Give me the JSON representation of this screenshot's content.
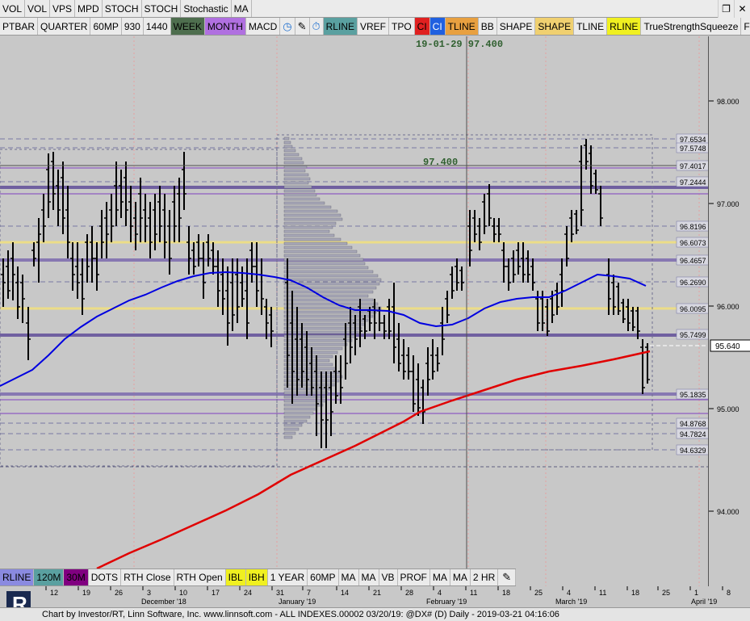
{
  "toolbar1": [
    {
      "label": "VOL",
      "bg": "#ebebeb"
    },
    {
      "label": "VOL",
      "bg": "#ebebeb"
    },
    {
      "label": "VPS",
      "bg": "#ebebeb"
    },
    {
      "label": "MPD",
      "bg": "#ebebeb"
    },
    {
      "label": "STOCH",
      "bg": "#ebebeb"
    },
    {
      "label": "STOCH",
      "bg": "#ebebeb"
    },
    {
      "label": "Stochastic",
      "bg": "#ebebeb"
    },
    {
      "label": "MA",
      "bg": "#ebebeb"
    }
  ],
  "toolbar2": [
    {
      "label": "PTBAR",
      "bg": "#ebebeb",
      "color": "#000"
    },
    {
      "label": "QUARTER",
      "bg": "#ebebeb",
      "color": "#000"
    },
    {
      "label": "60MP",
      "bg": "#ebebeb",
      "color": "#000"
    },
    {
      "label": "930",
      "bg": "#ebebeb",
      "color": "#000"
    },
    {
      "label": "1440",
      "bg": "#ebebeb",
      "color": "#000"
    },
    {
      "label": "WEEK",
      "bg": "#4e6e4e",
      "color": "#000"
    },
    {
      "label": "MONTH",
      "bg": "#b070e0",
      "color": "#000"
    },
    {
      "label": "MACD",
      "bg": "#ebebeb",
      "color": "#000"
    },
    {
      "icon": "clock-icon",
      "glyph": "◷",
      "bg": "#ebebeb",
      "color": "#1e6fd0"
    },
    {
      "icon": "pencil-icon",
      "glyph": "✎",
      "bg": "#ebebeb",
      "color": "#000"
    },
    {
      "icon": "stopwatch-icon",
      "glyph": "⏱",
      "bg": "#ebebeb",
      "color": "#1e6fd0"
    },
    {
      "label": "RLINE",
      "bg": "#5aa0a0",
      "color": "#000"
    },
    {
      "label": "VREF",
      "bg": "#ebebeb",
      "color": "#000"
    },
    {
      "label": "TPO",
      "bg": "#ebebeb",
      "color": "#000"
    },
    {
      "label": "CI",
      "bg": "#e02020",
      "color": "#000"
    },
    {
      "label": "CI",
      "bg": "#2060e0",
      "color": "#fff"
    },
    {
      "label": "TLINE",
      "bg": "#e8a040",
      "color": "#000"
    },
    {
      "label": "BB",
      "bg": "#ebebeb",
      "color": "#000"
    },
    {
      "label": "SHAPE",
      "bg": "#ebebeb",
      "color": "#000"
    },
    {
      "label": "SHAPE",
      "bg": "#f0d070",
      "color": "#000"
    },
    {
      "label": "TLINE",
      "bg": "#ebebeb",
      "color": "#000"
    },
    {
      "label": "RLINE",
      "bg": "#f0f020",
      "color": "#000"
    },
    {
      "label": "TrueStrengthSqueeze",
      "bg": "#ebebeb",
      "color": "#000"
    },
    {
      "label": "FIB",
      "bg": "#ebebeb",
      "color": "#000"
    }
  ],
  "bottombar": [
    {
      "label": "RLINE",
      "bg": "#8a8ae0",
      "color": "#000"
    },
    {
      "label": "120M",
      "bg": "#5aa0a0",
      "color": "#000"
    },
    {
      "label": "30M",
      "bg": "#800080",
      "color": "#000"
    },
    {
      "label": "DOTS",
      "bg": "#ebebeb",
      "color": "#000"
    },
    {
      "label": "RTH Close",
      "bg": "#ebebeb",
      "color": "#000"
    },
    {
      "label": "RTH Open",
      "bg": "#ebebeb",
      "color": "#000"
    },
    {
      "label": "IBL",
      "bg": "#f0f020",
      "color": "#000"
    },
    {
      "label": "IBH",
      "bg": "#f0f020",
      "color": "#000"
    },
    {
      "label": "1 YEAR",
      "bg": "#ebebeb",
      "color": "#000"
    },
    {
      "label": "60MP",
      "bg": "#ebebeb",
      "color": "#000"
    },
    {
      "label": "MA",
      "bg": "#ebebeb",
      "color": "#000"
    },
    {
      "label": "MA",
      "bg": "#ebebeb",
      "color": "#000"
    },
    {
      "label": "VB",
      "bg": "#ebebeb",
      "color": "#000"
    },
    {
      "label": "PROF",
      "bg": "#ebebeb",
      "color": "#000"
    },
    {
      "label": "MA",
      "bg": "#ebebeb",
      "color": "#000"
    },
    {
      "label": "MA",
      "bg": "#ebebeb",
      "color": "#000"
    },
    {
      "label": "2 HR",
      "bg": "#ebebeb",
      "color": "#000"
    },
    {
      "icon": "pencil-icon",
      "glyph": "✎",
      "bg": "#ebebeb",
      "color": "#000"
    }
  ],
  "window_controls": [
    {
      "icon": "restore-icon",
      "glyph": "❐"
    },
    {
      "icon": "close-icon",
      "glyph": "✕"
    }
  ],
  "crosshair_label": "19-01-29  97.400",
  "cursor_price_label": "97.400",
  "last_price": "95.640",
  "status_line": "Chart by Investor/RT, Linn Software, Inc. www.linnsoft.com - ALL INDEXES.00002       03/20/19: @DX# (D) Daily - 2019-03-21 04:16:06",
  "chart_data": {
    "type": "ohlc-bar",
    "y_axis_ticks": [
      "98.000",
      "97.000",
      "96.000",
      "95.000",
      "94.000"
    ],
    "price_levels": [
      {
        "label": "97.6534",
        "color": "#7070a0"
      },
      {
        "label": "97.5748",
        "color": "#7070a0"
      },
      {
        "label": "97.4017",
        "color": "#7070a0"
      },
      {
        "label": "97.2444",
        "color": "#7070a0"
      },
      {
        "label": "96.8196",
        "color": "#7070a0"
      },
      {
        "label": "96.6073",
        "color": "#f0e080"
      },
      {
        "label": "96.4657",
        "color": "#8070b0"
      },
      {
        "label": "96.2690",
        "color": "#7070a0"
      },
      {
        "label": "96.0095",
        "color": "#f0e080"
      },
      {
        "label": "95.7499",
        "color": "#7070a0"
      },
      {
        "label": "95.1835",
        "color": "#8070b0"
      },
      {
        "label": "94.8768",
        "color": "#7070a0"
      },
      {
        "label": "94.7824",
        "color": "#7070a0"
      },
      {
        "label": "94.6329",
        "color": "#7070a0"
      }
    ],
    "x_ticks": [
      "12",
      "19",
      "26",
      "3",
      "10",
      "17",
      "24",
      "31",
      "7",
      "14",
      "21",
      "28",
      "4",
      "11",
      "18",
      "25",
      "4",
      "11",
      "18",
      "25",
      "1",
      "8"
    ],
    "month_labels": [
      "December '18",
      "January '19",
      "February '19",
      "March '19",
      "April '19"
    ],
    "series": [
      {
        "name": "MA",
        "color": "#0000e0"
      },
      {
        "name": "MA",
        "color": "#e00000"
      }
    ]
  }
}
